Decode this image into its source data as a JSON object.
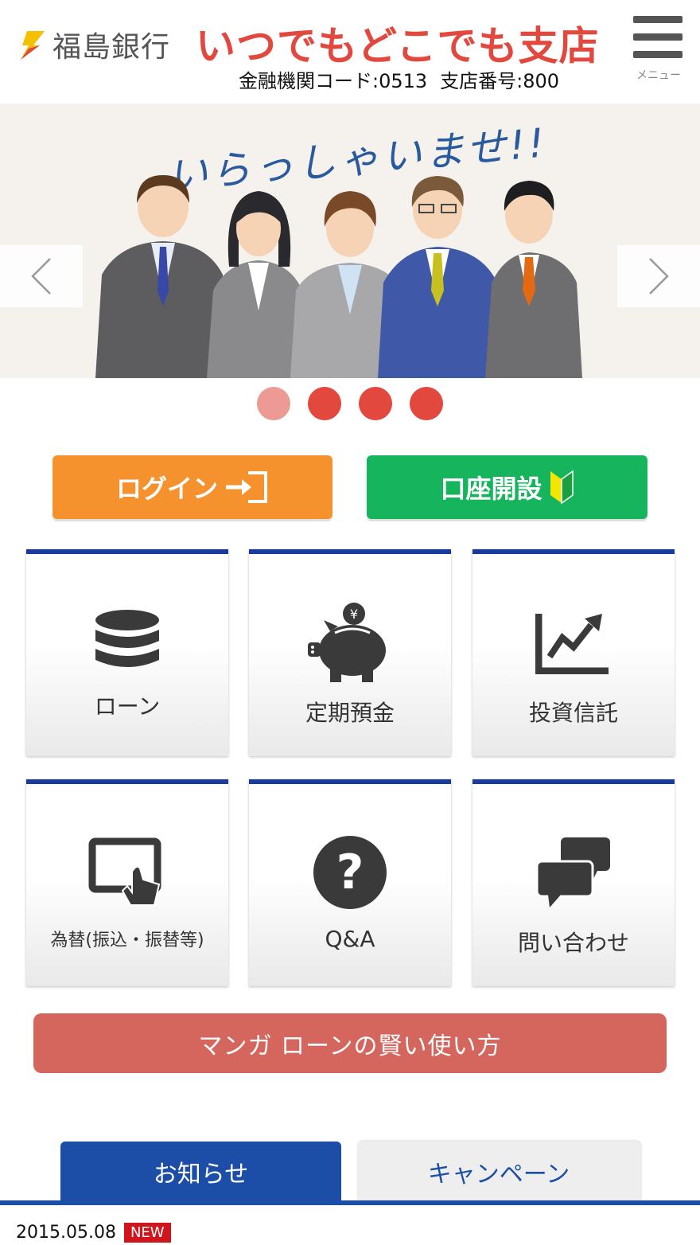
{
  "header": {
    "bank_name": "福島銀行",
    "branch_name": "いつでもどこでも支店",
    "institution_code": "金融機関コード:0513",
    "branch_number": "支店番号:800",
    "menu_label": "メニュー"
  },
  "banner": {
    "title": "いらっしゃいませ!!",
    "slide_count": 4,
    "active_slide": 1
  },
  "actions": {
    "login_label": "ログイン",
    "open_account_label": "口座開設"
  },
  "tiles": [
    {
      "label": "ローン",
      "icon": "coins-icon"
    },
    {
      "label": "定期預金",
      "icon": "piggy-bank-icon"
    },
    {
      "label": "投資信託",
      "icon": "chart-up-icon"
    },
    {
      "label": "為替(振込・振替等)",
      "icon": "tablet-touch-icon"
    },
    {
      "label": "Q&A",
      "icon": "question-icon"
    },
    {
      "label": "問い合わせ",
      "icon": "chat-bubbles-icon"
    }
  ],
  "manga": {
    "label": "マンガ ローンの賢い使い方"
  },
  "tabs": [
    {
      "label": "お知らせ",
      "active": true
    },
    {
      "label": "キャンペーン",
      "active": false
    }
  ],
  "news": [
    {
      "date": "2015.05.08",
      "badge": "NEW"
    }
  ],
  "colors": {
    "brand_red": "#e2483d",
    "brand_blue": "#1c4ea8",
    "login_orange": "#f5922e",
    "open_green": "#16b55d",
    "manga_red": "#d5665e",
    "new_badge": "#d0151f"
  }
}
